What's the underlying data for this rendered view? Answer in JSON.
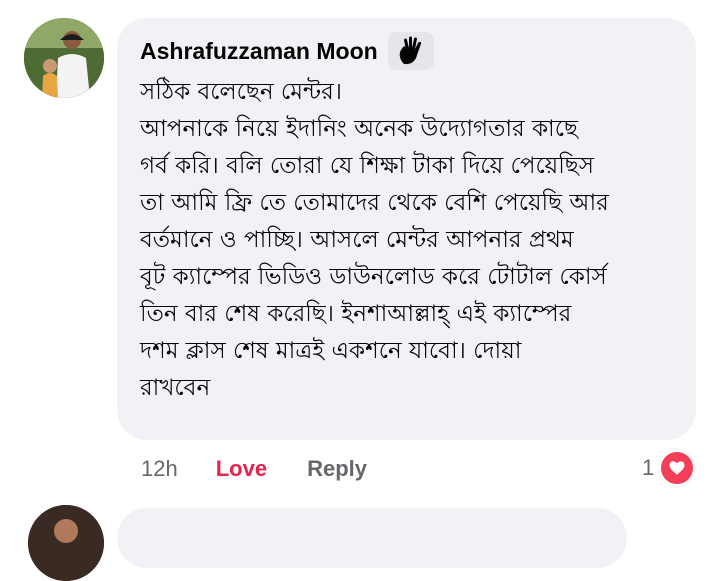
{
  "comment": {
    "author": "Ashrafuzzaman Moon",
    "author_badge_icon": "waving-hand-icon",
    "lines": [
      "সঠিক বলেছেন মেন্টর।",
      "আপনাকে নিয়ে ইদানিং অনেক উদ্যোগতার কাছে",
      "গর্ব করি। বলি তোরা যে শিক্ষা টাকা দিয়ে পেয়েছিস",
      "তা আমি ফ্রি তে তোমাদের থেকে বেশি পেয়েছি আর",
      "বর্তমানে ও পাচ্ছি। আসলে মেন্টর আপনার প্রথম",
      "বূট ক্যাম্পের ভিডিও ডাউনলোড করে টোটাল কোর্স",
      "তিন বার শেষ করেছি। ইনশাআল্লাহ্ এই ক্যাম্পের",
      "দশম ক্লাস শেষ মাত্রই একশনে যাবো। দোয়া",
      "রাখবেন"
    ]
  },
  "actions": {
    "time": "12h",
    "love_label": "Love",
    "reply_label": "Reply",
    "reaction_count": "1",
    "reaction_icon": "heart-icon"
  },
  "colors": {
    "bubble": "#f0f2f5",
    "love": "#e4264f",
    "secondary_text": "#65676b",
    "heart": "#f33e58"
  }
}
